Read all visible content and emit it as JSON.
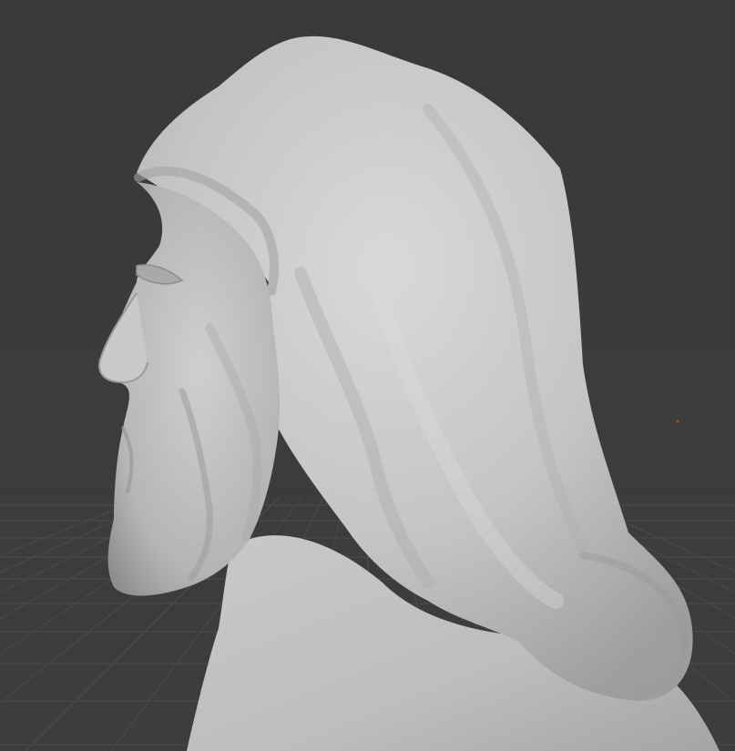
{
  "viewport": {
    "background_color": "#3a3a3a",
    "grid_line_color": "#4a4a4a",
    "sculpt_base_color": "#bdbdbd",
    "sculpt_highlight_color": "#e2e2e2",
    "sculpt_shadow_color": "#8f8f8f",
    "origin_marker_color": "#c0392b",
    "icons": [
      "3d-cursor-origin-icon"
    ]
  }
}
